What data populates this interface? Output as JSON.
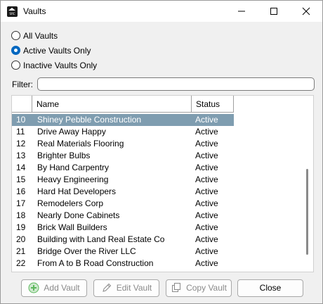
{
  "window": {
    "title": "Vaults",
    "app_icon_text": "SRC",
    "controls": [
      "minimize-icon",
      "maximize-icon",
      "close-icon"
    ]
  },
  "filter_options": [
    {
      "label": "All Vaults",
      "checked": false
    },
    {
      "label": "Active Vaults Only",
      "checked": true
    },
    {
      "label": "Inactive Vaults Only",
      "checked": false
    }
  ],
  "filter": {
    "label": "Filter:",
    "value": ""
  },
  "grid": {
    "columns": [
      "",
      "Name",
      "Status"
    ],
    "selected_index": 0,
    "rows": [
      {
        "id": "10",
        "name": "Shiney Pebble Construction",
        "status": "Active"
      },
      {
        "id": "11",
        "name": "Drive Away Happy",
        "status": "Active"
      },
      {
        "id": "12",
        "name": "Real Materials Flooring",
        "status": "Active"
      },
      {
        "id": "13",
        "name": "Brighter Bulbs",
        "status": "Active"
      },
      {
        "id": "14",
        "name": "By Hand Carpentry",
        "status": "Active"
      },
      {
        "id": "15",
        "name": "Heavy Engineering",
        "status": "Active"
      },
      {
        "id": "16",
        "name": "Hard Hat Developers",
        "status": "Active"
      },
      {
        "id": "17",
        "name": "Remodelers Corp",
        "status": "Active"
      },
      {
        "id": "18",
        "name": "Nearly Done Cabinets",
        "status": "Active"
      },
      {
        "id": "19",
        "name": "Brick Wall Builders",
        "status": "Active"
      },
      {
        "id": "20",
        "name": "Building with Land Real Estate Co",
        "status": "Active"
      },
      {
        "id": "21",
        "name": "Bridge Over the River LLC",
        "status": "Active"
      },
      {
        "id": "22",
        "name": "From A to B Road Construction",
        "status": "Active"
      }
    ]
  },
  "buttons": {
    "add": {
      "label": "Add Vault",
      "icon": "plus-circle-icon",
      "enabled": false
    },
    "edit": {
      "label": "Edit Vault",
      "icon": "pencil-icon",
      "enabled": false
    },
    "copy": {
      "label": "Copy Vault",
      "icon": "copy-icon",
      "enabled": false
    },
    "close": {
      "label": "Close",
      "enabled": true
    }
  },
  "colors": {
    "selection": "#7f9db0",
    "radio_accent": "#0067c0",
    "add_icon": "#5cb85c"
  }
}
